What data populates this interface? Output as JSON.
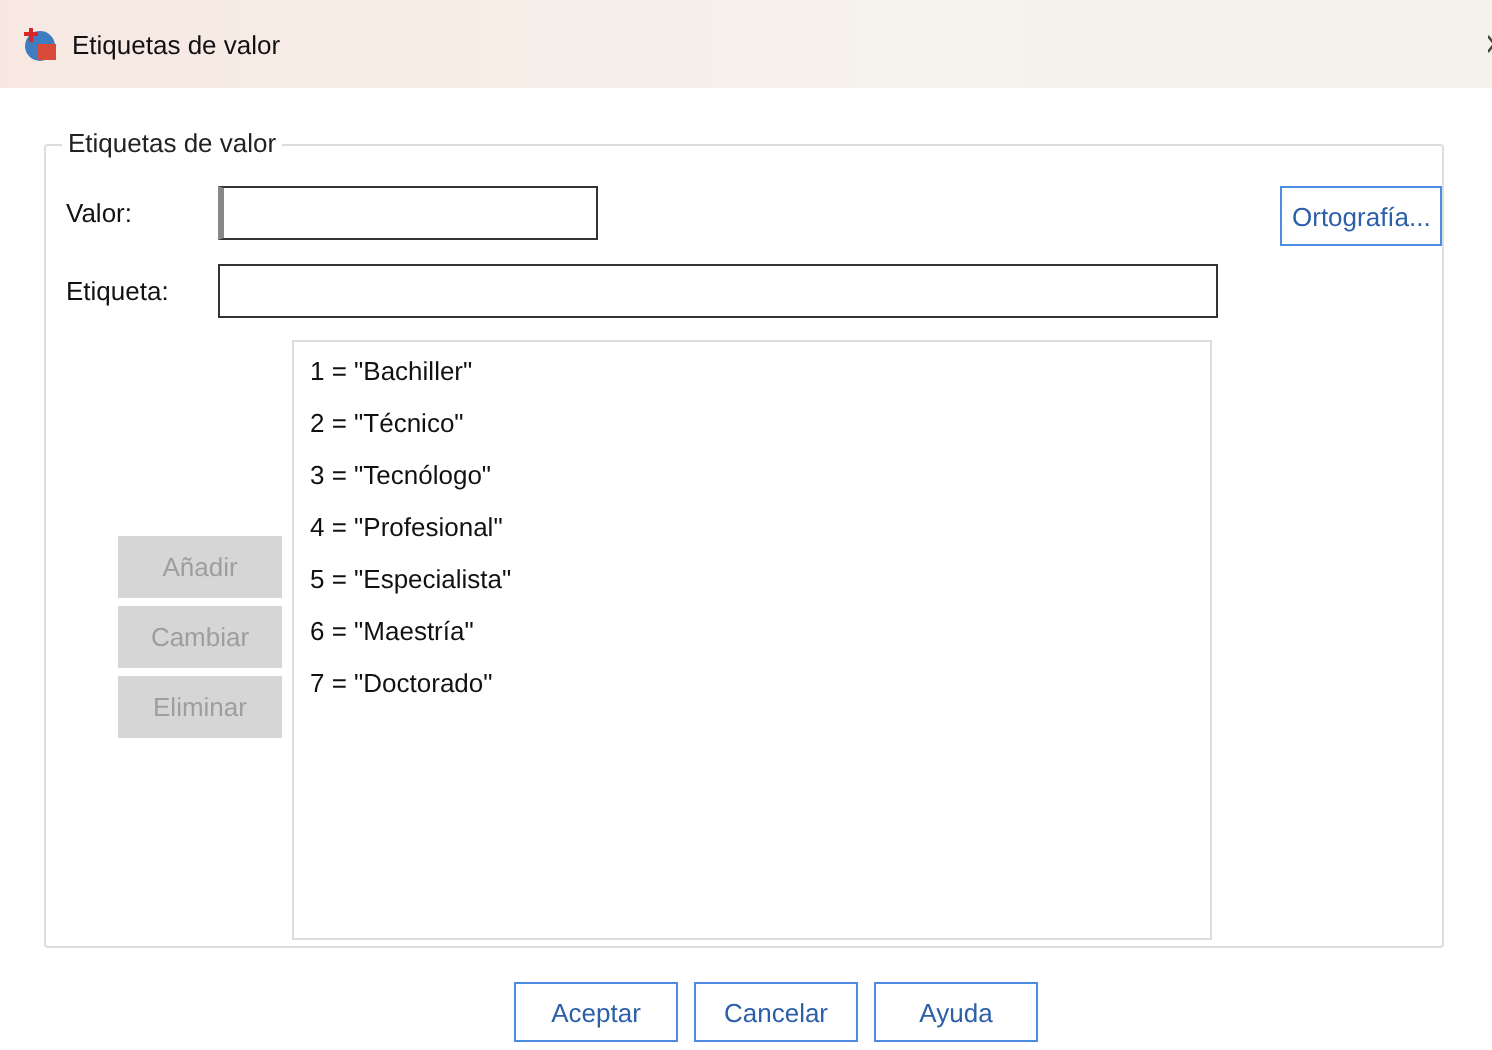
{
  "window": {
    "title": "Etiquetas de valor"
  },
  "group": {
    "title": "Etiquetas de valor"
  },
  "fields": [
    {
      "label": "Valor:",
      "focused": true
    },
    {
      "label": "Etiqueta:",
      "focused": false
    }
  ],
  "spelling_button": {
    "label": "Ortografía..."
  },
  "side_buttons": [
    {
      "label": "Añadir",
      "disabled": true
    },
    {
      "label": "Cambiar",
      "disabled": true
    },
    {
      "label": "Eliminar",
      "disabled": true
    }
  ],
  "labels_list": [
    {
      "text": "1 = \"Bachiller\""
    },
    {
      "text": "2 = \"Técnico\""
    },
    {
      "text": "3 = \"Tecnólogo\""
    },
    {
      "text": "4 = \"Profesional\""
    },
    {
      "text": "5 = \"Especialista\""
    },
    {
      "text": "6 = \"Maestría\""
    },
    {
      "text": "7 = \"Doctorado\""
    }
  ],
  "buttons": [
    {
      "label": "Aceptar"
    },
    {
      "label": "Cancelar"
    },
    {
      "label": "Ayuda"
    }
  ]
}
